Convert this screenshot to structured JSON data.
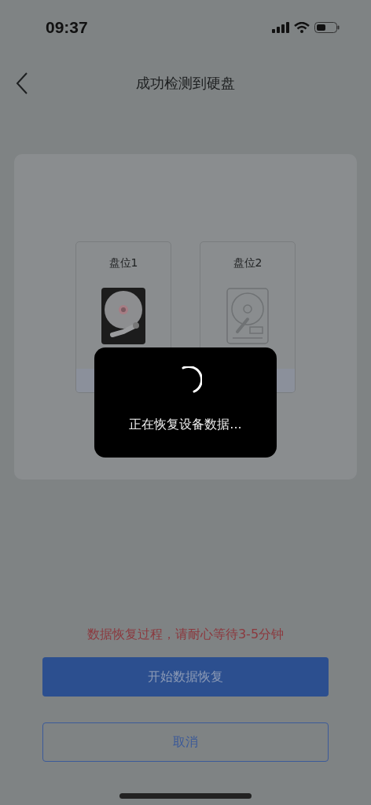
{
  "status_bar": {
    "time": "09:37"
  },
  "nav": {
    "title": "成功检测到硬盘"
  },
  "slots": [
    {
      "label": "盘位1",
      "occupied": true
    },
    {
      "label": "盘位2",
      "occupied": false
    }
  ],
  "toast": {
    "message": "正在恢复设备数据..."
  },
  "hint": "数据恢复过程，请耐心等待3-5分钟",
  "buttons": {
    "primary": "开始数据恢复",
    "secondary": "取消"
  }
}
